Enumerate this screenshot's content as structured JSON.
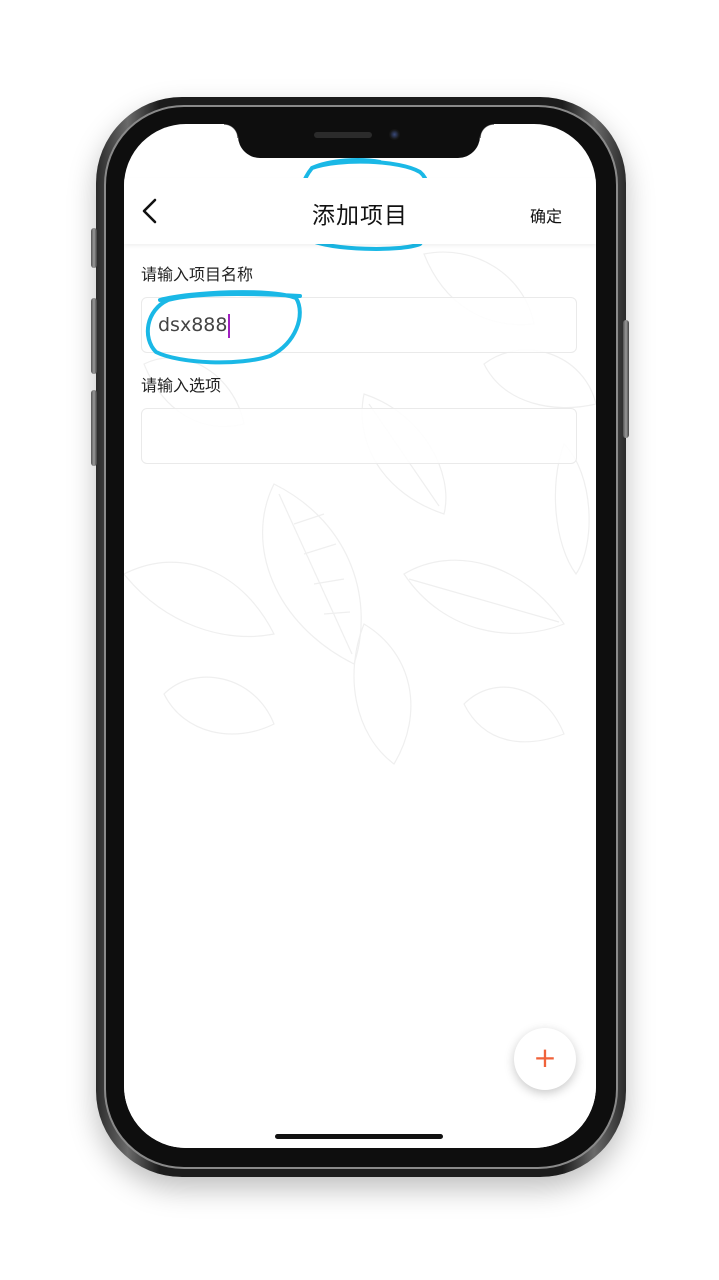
{
  "header": {
    "title": "添加项目",
    "confirm_label": "确定"
  },
  "form": {
    "name_label": "请输入项目名称",
    "name_value": "dsx888",
    "option_label": "请输入选项",
    "option_value": ""
  },
  "fab": {
    "icon": "plus-icon",
    "symbol": "+"
  },
  "colors": {
    "fab_plus": "#f0623a",
    "annotation": "#1ab8e6",
    "caret": "#a020c0"
  }
}
